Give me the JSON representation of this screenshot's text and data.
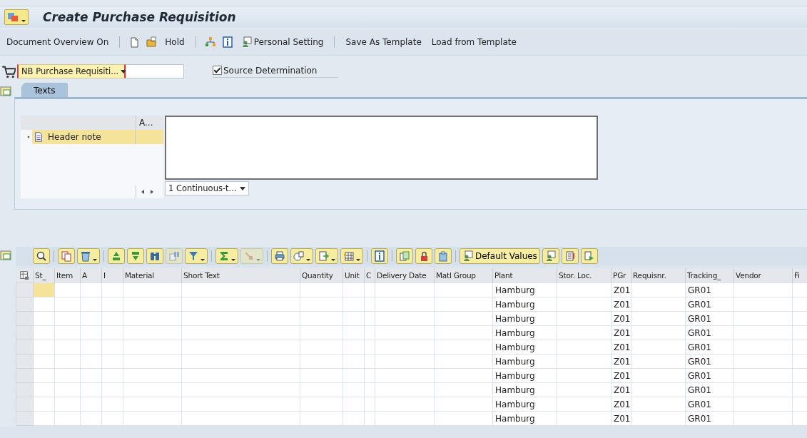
{
  "window": {
    "title": "Create Purchase Requisition"
  },
  "toolbar": [
    {
      "kind": "text",
      "label": "Document Overview On"
    },
    {
      "kind": "separator"
    },
    {
      "kind": "icon"
    },
    {
      "kind": "icon"
    },
    {
      "kind": "text",
      "label": "Hold"
    },
    {
      "kind": "separator"
    },
    {
      "kind": "icon"
    },
    {
      "kind": "icon"
    },
    {
      "kind": "icon-text",
      "label": "Personal Setting"
    },
    {
      "kind": "separator"
    },
    {
      "kind": "text",
      "label": "Save As Template"
    },
    {
      "kind": "text",
      "label": "Load from Template"
    }
  ],
  "header": {
    "document_type": "NB Purchase Requisiti...",
    "source_determination": {
      "label": "Source Determination",
      "checked": true
    }
  },
  "tabs": [
    {
      "label": "Texts",
      "selected": true
    }
  ],
  "texts_panel": {
    "tree_column": "A...",
    "items": [
      {
        "label": "Header note",
        "selected": true
      }
    ],
    "format": "1 Continuous-t..."
  },
  "table_toolbar": [
    {
      "kind": "icon",
      "menu": false,
      "disabled": false
    },
    {
      "kind": "separator"
    },
    {
      "kind": "icon",
      "menu": false,
      "disabled": false
    },
    {
      "kind": "icon",
      "menu": true,
      "disabled": false
    },
    {
      "kind": "separator"
    },
    {
      "kind": "icon",
      "menu": false,
      "disabled": false
    },
    {
      "kind": "icon",
      "menu": false,
      "disabled": false
    },
    {
      "kind": "icon",
      "menu": false,
      "disabled": false
    },
    {
      "kind": "icon",
      "menu": false,
      "disabled": true
    },
    {
      "kind": "icon",
      "menu": true,
      "disabled": false
    },
    {
      "kind": "separator"
    },
    {
      "kind": "icon",
      "menu": true,
      "disabled": false
    },
    {
      "kind": "icon",
      "menu": true,
      "disabled": true
    },
    {
      "kind": "separator"
    },
    {
      "kind": "icon",
      "menu": false,
      "disabled": false
    },
    {
      "kind": "icon",
      "menu": true,
      "disabled": false
    },
    {
      "kind": "icon",
      "menu": true,
      "disabled": false
    },
    {
      "kind": "icon",
      "menu": true,
      "disabled": false
    },
    {
      "kind": "separator"
    },
    {
      "kind": "icon",
      "menu": false,
      "disabled": false
    },
    {
      "kind": "separator"
    },
    {
      "kind": "icon",
      "menu": false,
      "disabled": false
    },
    {
      "kind": "icon",
      "menu": false,
      "disabled": false
    },
    {
      "kind": "icon",
      "menu": false,
      "disabled": false
    },
    {
      "kind": "separator"
    },
    {
      "kind": "icon-text",
      "label": "Default Values",
      "menu": false,
      "disabled": false
    },
    {
      "kind": "icon",
      "menu": false,
      "disabled": false
    },
    {
      "kind": "icon",
      "menu": false,
      "disabled": false
    },
    {
      "kind": "icon",
      "menu": false,
      "disabled": false
    }
  ],
  "table": {
    "columns": [
      "St_",
      "Item",
      "A",
      "I",
      "Material",
      "Short Text",
      "Quantity",
      "Unit",
      "C",
      "Delivery Date",
      "Matl Group",
      "Plant",
      "Stor. Loc.",
      "PGr",
      "Requisnr.",
      "Tracking_",
      "Vendor",
      "Fi"
    ],
    "rows": [
      {
        "focused": true,
        "plant": "Hamburg",
        "pgr": "Z01",
        "tracking": "GR01"
      },
      {
        "focused": false,
        "plant": "Hamburg",
        "pgr": "Z01",
        "tracking": "GR01"
      },
      {
        "focused": false,
        "plant": "Hamburg",
        "pgr": "Z01",
        "tracking": "GR01"
      },
      {
        "focused": false,
        "plant": "Hamburg",
        "pgr": "Z01",
        "tracking": "GR01"
      },
      {
        "focused": false,
        "plant": "Hamburg",
        "pgr": "Z01",
        "tracking": "GR01"
      },
      {
        "focused": false,
        "plant": "Hamburg",
        "pgr": "Z01",
        "tracking": "GR01"
      },
      {
        "focused": false,
        "plant": "Hamburg",
        "pgr": "Z01",
        "tracking": "GR01"
      },
      {
        "focused": false,
        "plant": "Hamburg",
        "pgr": "Z01",
        "tracking": "GR01"
      },
      {
        "focused": false,
        "plant": "Hamburg",
        "pgr": "Z01",
        "tracking": "GR01"
      },
      {
        "focused": false,
        "plant": "Hamburg",
        "pgr": "Z01",
        "tracking": "GR01"
      }
    ]
  }
}
